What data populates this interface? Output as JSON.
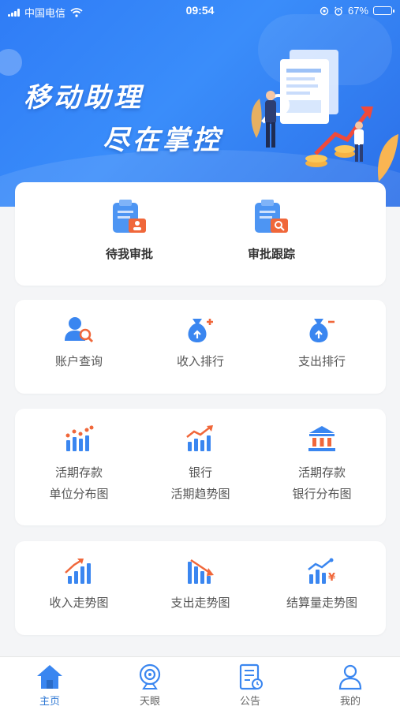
{
  "status_bar": {
    "carrier": "中国电信",
    "time": "09:54",
    "battery": "67%",
    "battery_level": 0.67
  },
  "banner": {
    "line1": "移动助理",
    "line2": "尽在掌控"
  },
  "approval": {
    "items": [
      {
        "label": "待我审批",
        "icon": "clipboard-user-icon"
      },
      {
        "label": "审批跟踪",
        "icon": "clipboard-search-icon"
      }
    ]
  },
  "account": {
    "items": [
      {
        "label": "账户查询",
        "icon": "user-search-icon"
      },
      {
        "label": "收入排行",
        "icon": "money-bag-plus-icon"
      },
      {
        "label": "支出排行",
        "icon": "money-bag-minus-icon"
      }
    ]
  },
  "deposit": {
    "items": [
      {
        "line1": "活期存款",
        "line2": "单位分布图",
        "icon": "scatter-bars-icon"
      },
      {
        "line1": "银行",
        "line2": "活期趋势图",
        "icon": "trend-up-bars-icon"
      },
      {
        "line1": "活期存款",
        "line2": "银行分布图",
        "icon": "bank-icon"
      }
    ]
  },
  "trends": {
    "items": [
      {
        "label": "收入走势图",
        "icon": "income-trend-icon"
      },
      {
        "label": "支出走势图",
        "icon": "expense-trend-icon"
      },
      {
        "label": "结算量走势图",
        "icon": "settlement-trend-icon"
      }
    ]
  },
  "tabbar": {
    "tabs": [
      {
        "label": "主页",
        "icon": "home-icon",
        "active": true
      },
      {
        "label": "天眼",
        "icon": "camera-eye-icon",
        "active": false
      },
      {
        "label": "公告",
        "icon": "notice-icon",
        "active": false
      },
      {
        "label": "我的",
        "icon": "profile-icon",
        "active": false
      }
    ]
  },
  "colors": {
    "primary_blue": "#3a86f0",
    "accent_orange": "#f0673a",
    "active_tab": "#2f78d4"
  }
}
